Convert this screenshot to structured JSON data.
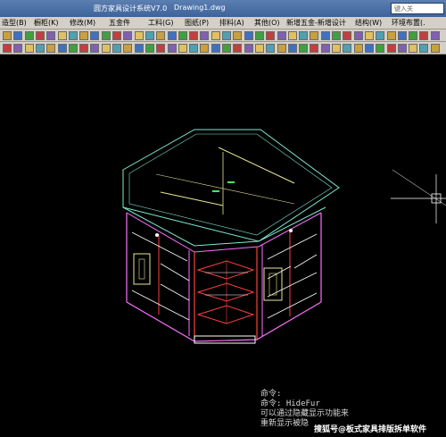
{
  "window": {
    "app_title": "圆方家具设计系统V7.0",
    "document": "Drawing1.dwg",
    "search_placeholder": "键入关"
  },
  "menu": [
    {
      "label": "造型(B)"
    },
    {
      "label": "橱柜(K)"
    },
    {
      "label": "修改(M)"
    },
    {
      "label": "五金件"
    },
    {
      "label": "工料(G)"
    },
    {
      "label": "图纸(P)"
    },
    {
      "label": "排料(A)"
    },
    {
      "label": "其他(O)"
    },
    {
      "label": "新增五金-新增设计"
    },
    {
      "label": "结构(W)"
    },
    {
      "label": "环境布置(."
    }
  ],
  "command_line": [
    "命令:",
    "命令: HideFur",
    "可以通过隐藏显示功能来",
    "重新显示被隐"
  ],
  "watermark": "搜狐号@板式家具排版拆单软件",
  "colors": {
    "canvas_bg": "#000000",
    "wire_cyan": "#7fe8d0",
    "wire_red": "#ff4040",
    "wire_pink": "#ff70ff",
    "wire_yellow": "#e8e890",
    "wire_green": "#40ff60",
    "wire_white": "#ffffff"
  }
}
